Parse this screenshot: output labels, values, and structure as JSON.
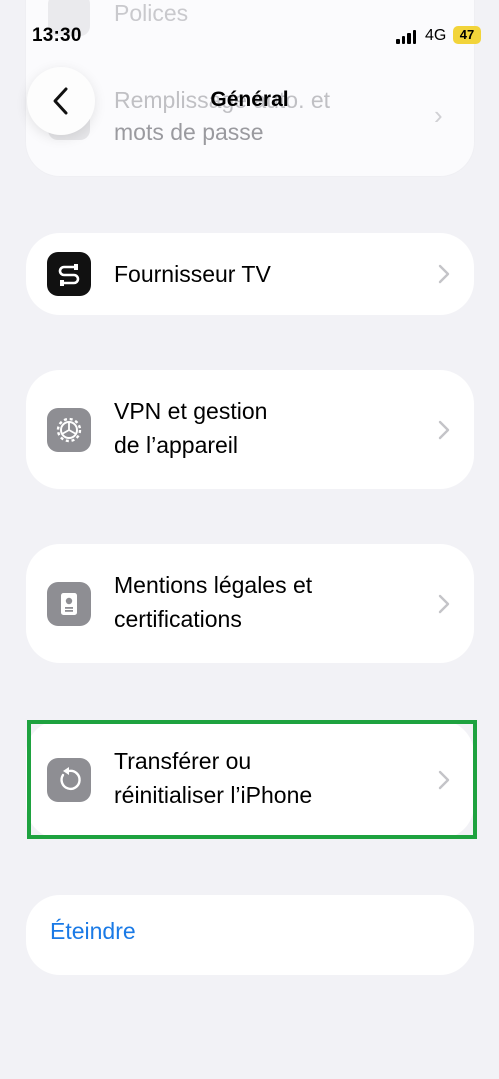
{
  "status_bar": {
    "time": "13:30",
    "network": "4G",
    "battery": "47"
  },
  "ghost": {
    "row1": "Polices",
    "row2_line1": "Remplissage auto. et",
    "row2_line2": "mots de passe"
  },
  "nav": {
    "title": "Général"
  },
  "items": [
    {
      "label": "Fournisseur TV",
      "icon": "tv-provider-icon"
    },
    {
      "label_line1": "VPN et gestion",
      "label_line2": "de l’appareil",
      "icon": "gear-icon"
    },
    {
      "label_line1": "Mentions légales et",
      "label_line2": "certifications",
      "icon": "certificate-icon"
    },
    {
      "label_line1": "Transférer ou",
      "label_line2": "réinitialiser l’iPhone",
      "icon": "reset-icon"
    }
  ],
  "shutdown": {
    "label": "Éteindre"
  },
  "colors": {
    "accent": "#1a7ae6",
    "highlight": "#1ea23f",
    "background": "#f2f2f6"
  }
}
